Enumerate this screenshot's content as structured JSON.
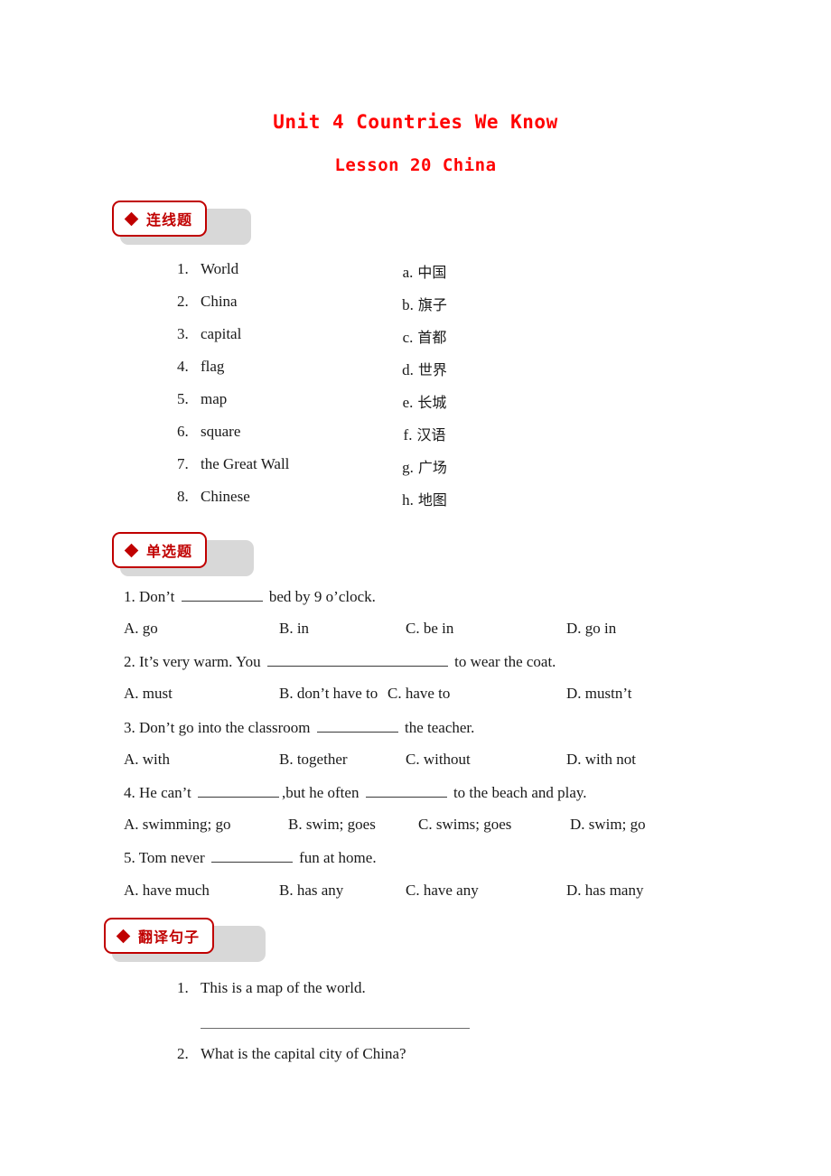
{
  "document": {
    "title_main": "Unit 4 Countries We Know",
    "title_sub": "Lesson 20 China",
    "title_color": "#ff0000",
    "accent_color": "#c00000"
  },
  "sections": [
    {
      "badge_label": "连线题",
      "badge_icon": "diamond-bullet-icon",
      "type": "matching"
    },
    {
      "badge_label": "单选题",
      "badge_icon": "diamond-bullet-icon",
      "type": "multiple-choice"
    },
    {
      "badge_label": "翻译句子",
      "badge_icon": "diamond-bullet-icon",
      "type": "translation"
    }
  ],
  "matching": {
    "left": [
      {
        "num": "1.",
        "text": "World"
      },
      {
        "num": "2.",
        "text": "China"
      },
      {
        "num": "3.",
        "text": "capital"
      },
      {
        "num": "4.",
        "text": "flag"
      },
      {
        "num": "5.",
        "text": "map"
      },
      {
        "num": "6.",
        "text": "square"
      },
      {
        "num": "7.",
        "text": "the Great Wall"
      },
      {
        "num": "8.",
        "text": "Chinese"
      }
    ],
    "right": [
      {
        "ltr": "a.",
        "text": "中国"
      },
      {
        "ltr": "b.",
        "text": "旗子"
      },
      {
        "ltr": "c.",
        "text": "首都"
      },
      {
        "ltr": "d.",
        "text": "世界"
      },
      {
        "ltr": "e.",
        "text": "长城"
      },
      {
        "ltr": "f.",
        "text": "汉语"
      },
      {
        "ltr": "g.",
        "text": "广场"
      },
      {
        "ltr": "h.",
        "text": "地图"
      }
    ]
  },
  "multiple_choice": {
    "questions": [
      {
        "stem_before": "1. Don’t",
        "stem_after": "bed by 9 o’clock.",
        "blank_width": 90,
        "options": [
          {
            "label": "A. go"
          },
          {
            "label": "B. in"
          },
          {
            "label": "C. be in"
          },
          {
            "label": "D. go in"
          }
        ]
      },
      {
        "stem_before": "2. It’s very warm. You",
        "stem_after": "to wear the coat.",
        "blank_width": 200,
        "options": [
          {
            "label": "A. must"
          },
          {
            "label": "B. don’t have to"
          },
          {
            "label": "C. have to"
          },
          {
            "label": "D. mustn’t"
          }
        ]
      },
      {
        "stem_before": "3. Don’t go into the classroom",
        "stem_after": "the teacher.",
        "blank_width": 90,
        "options": [
          {
            "label": "A. with"
          },
          {
            "label": "B. together"
          },
          {
            "label": "C. without"
          },
          {
            "label": "D. with not"
          }
        ]
      },
      {
        "stem_before": "4. He can’t",
        "stem_mid": ",but he often",
        "stem_after": "to the beach and play.",
        "blank_width": 90,
        "options": [
          {
            "label": "A. swimming; go"
          },
          {
            "label": "B. swim; goes"
          },
          {
            "label": "C. swims; goes"
          },
          {
            "label": "D. swim; go"
          }
        ]
      },
      {
        "stem_before": "5. Tom never",
        "stem_after": "fun at home.",
        "blank_width": 90,
        "options": [
          {
            "label": "A. have much"
          },
          {
            "label": "B. has any"
          },
          {
            "label": "C. have any"
          },
          {
            "label": "D. has many"
          }
        ]
      }
    ]
  },
  "translation": {
    "items": [
      {
        "num": "1.",
        "text": "This is a map of the world."
      },
      {
        "num": "2.",
        "text": "What is the capital city of China?"
      }
    ]
  }
}
